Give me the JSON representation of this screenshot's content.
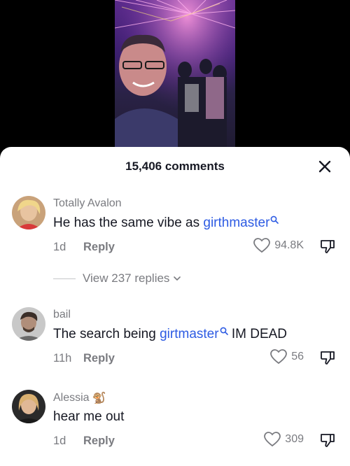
{
  "sheet": {
    "comment_count": "15,406 comments"
  },
  "comments": [
    {
      "username": "Totally Avalon",
      "text_before": "He has the same vibe as ",
      "search_term": "girthmaster",
      "text_after": "",
      "time": "1d",
      "reply_label": "Reply",
      "likes": "94.8K",
      "view_replies": "View 237 replies"
    },
    {
      "username": "bail",
      "text_before": "The search being ",
      "search_term": "girtmaster",
      "text_after": " IM DEAD",
      "time": "11h",
      "reply_label": "Reply",
      "likes": "56"
    },
    {
      "username": "Alessia",
      "username_emoji": "🐒",
      "text_before": "hear me out",
      "time": "1d",
      "reply_label": "Reply",
      "likes": "309"
    }
  ],
  "colors": {
    "link": "#2d5be3",
    "muted": "#7a7b80",
    "text": "#161823"
  },
  "icons": [
    "close-icon",
    "search-icon",
    "heart-icon",
    "dislike-icon",
    "chevron-down-icon"
  ]
}
